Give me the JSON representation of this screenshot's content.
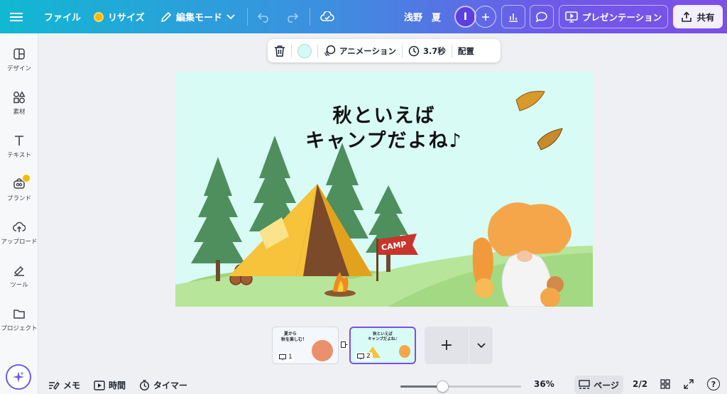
{
  "topbar": {
    "menu_icon": "hamburger-icon",
    "file_label": "ファイル",
    "resize_label": "リサイズ",
    "edit_mode_label": "編集モード",
    "user_name": "浅野　夏",
    "avatar_initial": "I",
    "present_label": "プレゼンテーション",
    "share_label": "共有"
  },
  "sidebar": {
    "items": [
      {
        "label": "デザイン",
        "icon": "design-icon"
      },
      {
        "label": "素材",
        "icon": "elements-icon"
      },
      {
        "label": "テキスト",
        "icon": "text-icon"
      },
      {
        "label": "ブランド",
        "icon": "brand-icon"
      },
      {
        "label": "アップロード",
        "icon": "upload-icon"
      },
      {
        "label": "ツール",
        "icon": "tools-icon"
      },
      {
        "label": "プロジェクト",
        "icon": "folder-icon"
      }
    ]
  },
  "context_toolbar": {
    "animation_label": "アニメーション",
    "duration_label": "3.7秒",
    "position_label": "配置",
    "bg_color": "#d4faf6"
  },
  "canvas": {
    "title_line1": "秋といえば",
    "title_line2": "キャンプだよね♪",
    "flag_text": "CAMP",
    "bg_color": "#d8fbf6"
  },
  "pages": {
    "thumb1_num": "1",
    "thumb1_line1": "夏から",
    "thumb1_line2": "秋を楽しむ！",
    "thumb2_num": "2",
    "thumb2_line1": "秋といえば",
    "thumb2_line2": "キャンプだよね♪",
    "add_label": "+"
  },
  "bottombar": {
    "notes_label": "メモ",
    "time_label": "時間",
    "timer_label": "タイマー",
    "zoom_percent": "36%",
    "zoom_value": 36,
    "page_label": "ページ",
    "page_count": "2/2",
    "help_label": "?"
  },
  "colors": {
    "accent": "#7d4fe6",
    "topbar_start": "#11b8d2",
    "topbar_end": "#7d4fe6"
  }
}
